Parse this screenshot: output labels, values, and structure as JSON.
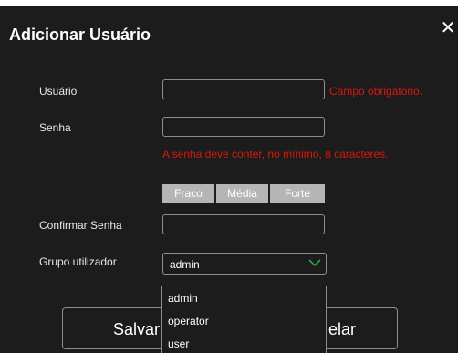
{
  "dialog": {
    "title": "Adicionar Usuário",
    "close_icon": "close-icon"
  },
  "form": {
    "username": {
      "label": "Usuário",
      "value": "",
      "error": "Campo obrigatório."
    },
    "password": {
      "label": "Senha",
      "value": "",
      "error": "A senha deve conter, no mínimo, 8 caracteres.",
      "strength_levels": [
        "Fraco",
        "Média",
        "Forte"
      ]
    },
    "confirm_password": {
      "label": "Confirmar Senha",
      "value": ""
    },
    "group": {
      "label": "Grupo utilizador",
      "selected": "admin",
      "options": [
        "admin",
        "operator",
        "user"
      ]
    }
  },
  "buttons": {
    "save": "Salvar",
    "cancel_partial": "elar"
  },
  "colors": {
    "background": "#1c1c1c",
    "error": "#d8180f",
    "chevron": "#2db84a",
    "strength_bar": "#b5b5b5"
  }
}
